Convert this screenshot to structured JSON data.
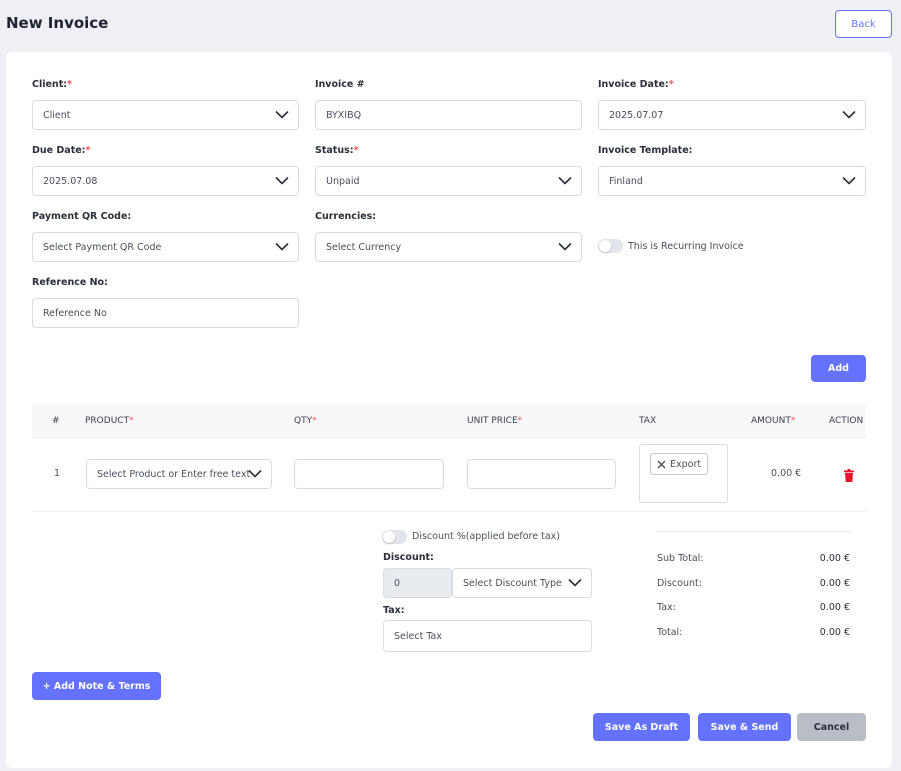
{
  "header": {
    "title": "New Invoice",
    "back_label": "Back"
  },
  "form": {
    "client": {
      "label": "Client:",
      "value": "Client"
    },
    "invoice_number": {
      "label": "Invoice #",
      "value": "BYXIBQ"
    },
    "invoice_date": {
      "label": "Invoice Date:",
      "value": "2025.07.07"
    },
    "due_date": {
      "label": "Due Date:",
      "value": "2025.07.08"
    },
    "status": {
      "label": "Status:",
      "value": "Unpaid"
    },
    "invoice_template": {
      "label": "Invoice Template:",
      "value": "Finland"
    },
    "payment_qr": {
      "label": "Payment QR Code:",
      "placeholder": "Select Payment QR Code"
    },
    "currencies": {
      "label": "Currencies:",
      "placeholder": "Select Currency"
    },
    "recurring": {
      "label": "This is Recurring Invoice",
      "enabled": false
    },
    "reference": {
      "label": "Reference No:",
      "placeholder": "Reference No"
    },
    "required_mark": "*"
  },
  "items": {
    "add_label": "Add",
    "columns": [
      "#",
      "PRODUCT",
      "QTY",
      "UNIT PRICE",
      "TAX",
      "AMOUNT",
      "ACTION"
    ],
    "rows": [
      {
        "index": "1",
        "product_placeholder": "Select Product or Enter free text",
        "qty": "",
        "unit_price": "",
        "tax_chip": "Export",
        "amount": "0.00 €"
      }
    ]
  },
  "discount": {
    "toggle_label": "Discount %(applied before tax)",
    "toggle_enabled": false,
    "label": "Discount:",
    "value": "0",
    "type_placeholder": "Select Discount Type",
    "tax_label": "Tax:",
    "tax_placeholder": "Select Tax"
  },
  "summary": {
    "sub_total_label": "Sub Total:",
    "sub_total": "0.00 €",
    "discount_label": "Discount:",
    "discount": "0.00 €",
    "tax_label": "Tax:",
    "tax": "0.00 €",
    "total_label": "Total:",
    "total": "0.00 €"
  },
  "footer": {
    "add_note_label": "+ Add Note & Terms",
    "save_draft_label": "Save As Draft",
    "save_send_label": "Save & Send",
    "cancel_label": "Cancel"
  },
  "colors": {
    "accent": "#6571ff",
    "danger": "#e8152d",
    "required": "#ff4d4d"
  }
}
